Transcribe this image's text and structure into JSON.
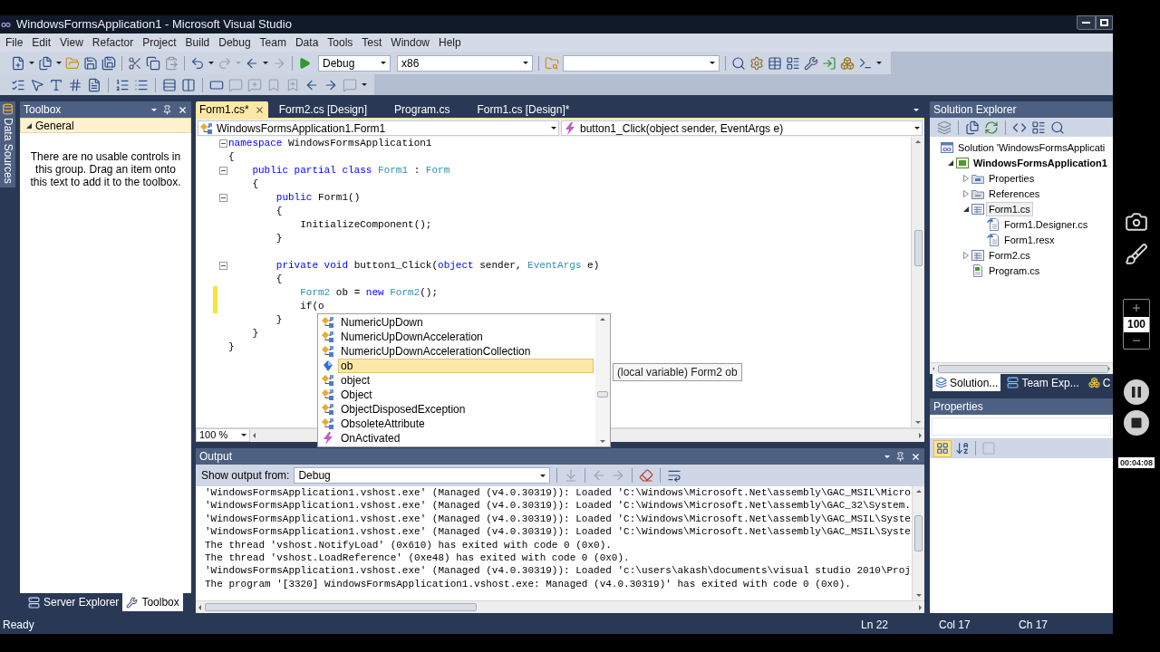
{
  "window": {
    "title": "WindowsFormsApplication1 - Microsoft Visual Studio"
  },
  "menu": [
    "File",
    "Edit",
    "View",
    "Refactor",
    "Project",
    "Build",
    "Debug",
    "Team",
    "Data",
    "Tools",
    "Test",
    "Window",
    "Help"
  ],
  "toolbar": {
    "configuration": "Debug",
    "platform": "x86"
  },
  "side_tab": {
    "label": "Data Sources"
  },
  "toolbox": {
    "title": "Toolbox",
    "group": {
      "label": "General",
      "expanded": true
    },
    "message": "There are no usable controls in this group. Drag an item onto this text to add it to the toolbox.",
    "tabs": [
      {
        "label": "Server Explorer",
        "kind": "server",
        "selected": false
      },
      {
        "label": "Toolbox",
        "kind": "toolbox",
        "selected": true
      }
    ]
  },
  "document_tabs": [
    {
      "label": "Form1.cs*",
      "selected": true
    },
    {
      "label": "Form2.cs [Design]",
      "selected": false
    },
    {
      "label": "Program.cs",
      "selected": false
    },
    {
      "label": "Form1.cs [Design]*",
      "selected": false
    }
  ],
  "editor": {
    "type_selector": "WindowsFormsApplication1.Form1",
    "member_selector": "button1_Click(object sender, EventArgs e)",
    "zoom": "100 %",
    "lines": [
      {
        "fold": true,
        "changed": false,
        "tokens": [
          {
            "kind": "keyword",
            "text": "namespace "
          },
          {
            "kind": "plain",
            "text": "WindowsFormsApplication1"
          }
        ]
      },
      {
        "fold": false,
        "changed": false,
        "tokens": [
          {
            "kind": "plain",
            "text": "{"
          }
        ]
      },
      {
        "fold": true,
        "changed": false,
        "tokens": [
          {
            "kind": "keyword",
            "text": "    public partial class "
          },
          {
            "kind": "type",
            "text": "Form1"
          },
          {
            "kind": "plain",
            "text": " : "
          },
          {
            "kind": "type",
            "text": "Form"
          }
        ]
      },
      {
        "fold": false,
        "changed": false,
        "tokens": [
          {
            "kind": "plain",
            "text": "    {"
          }
        ]
      },
      {
        "fold": true,
        "changed": false,
        "tokens": [
          {
            "kind": "keyword",
            "text": "        public "
          },
          {
            "kind": "plain",
            "text": "Form1()"
          }
        ]
      },
      {
        "fold": false,
        "changed": false,
        "tokens": [
          {
            "kind": "plain",
            "text": "        {"
          }
        ]
      },
      {
        "fold": false,
        "changed": false,
        "tokens": [
          {
            "kind": "plain",
            "text": "            InitializeComponent();"
          }
        ]
      },
      {
        "fold": false,
        "changed": false,
        "tokens": [
          {
            "kind": "plain",
            "text": "        }"
          }
        ]
      },
      {
        "fold": false,
        "changed": false
      },
      {
        "fold": true,
        "changed": false,
        "tokens": [
          {
            "kind": "keyword",
            "text": "        private void "
          },
          {
            "kind": "plain",
            "text": "button1_Click("
          },
          {
            "kind": "keyword",
            "text": "object"
          },
          {
            "kind": "plain",
            "text": " sender, "
          },
          {
            "kind": "type",
            "text": "EventArgs"
          },
          {
            "kind": "plain",
            "text": " e)"
          }
        ]
      },
      {
        "fold": false,
        "changed": false,
        "tokens": [
          {
            "kind": "plain",
            "text": "        {"
          }
        ]
      },
      {
        "fold": false,
        "changed": true,
        "tokens": [
          {
            "kind": "type",
            "text": "            Form2"
          },
          {
            "kind": "plain",
            "text": " ob = "
          },
          {
            "kind": "keyword",
            "text": "new "
          },
          {
            "kind": "type",
            "text": "Form2"
          },
          {
            "kind": "plain",
            "text": "();"
          }
        ]
      },
      {
        "fold": false,
        "changed": true,
        "tokens": [
          {
            "kind": "plain",
            "text": "            if(o"
          }
        ]
      },
      {
        "fold": false,
        "changed": false,
        "tokens": [
          {
            "kind": "plain",
            "text": "        }"
          }
        ]
      },
      {
        "fold": false,
        "changed": false,
        "tokens": [
          {
            "kind": "plain",
            "text": "    }"
          }
        ]
      },
      {
        "fold": false,
        "changed": false,
        "tokens": [
          {
            "kind": "plain",
            "text": "}"
          }
        ]
      }
    ]
  },
  "completion": {
    "items": [
      {
        "label": "NumericUpDown",
        "kind": "class",
        "selected": false
      },
      {
        "label": "NumericUpDownAcceleration",
        "kind": "class",
        "selected": false
      },
      {
        "label": "NumericUpDownAccelerationCollection",
        "kind": "class",
        "selected": false
      },
      {
        "label": "ob",
        "kind": "local",
        "selected": true
      },
      {
        "label": "object",
        "kind": "class",
        "selected": false
      },
      {
        "label": "Object",
        "kind": "class",
        "selected": false
      },
      {
        "label": "ObjectDisposedException",
        "kind": "class",
        "selected": false
      },
      {
        "label": "ObsoleteAttribute",
        "kind": "class",
        "selected": false
      },
      {
        "label": "OnActivated",
        "kind": "event",
        "selected": false
      }
    ],
    "tooltip": "(local variable) Form2 ob"
  },
  "output": {
    "title": "Output",
    "source_label": "Show output from:",
    "source": "Debug",
    "lines": [
      "'WindowsFormsApplication1.vshost.exe' (Managed (v4.0.30319)): Loaded 'C:\\Windows\\Microsoft.Net\\assembly\\GAC_MSIL\\Micro",
      "'WindowsFormsApplication1.vshost.exe' (Managed (v4.0.30319)): Loaded 'C:\\Windows\\Microsoft.Net\\assembly\\GAC_32\\System.",
      "'WindowsFormsApplication1.vshost.exe' (Managed (v4.0.30319)): Loaded 'C:\\Windows\\Microsoft.Net\\assembly\\GAC_MSIL\\Syste",
      "'WindowsFormsApplication1.vshost.exe' (Managed (v4.0.30319)): Loaded 'C:\\Windows\\Microsoft.Net\\assembly\\GAC_MSIL\\Syste",
      "The thread 'vshost.NotifyLoad' (0x610) has exited with code 0 (0x0).",
      "The thread 'vshost.LoadReference' (0xe48) has exited with code 0 (0x0).",
      "'WindowsFormsApplication1.vshost.exe' (Managed (v4.0.30319)): Loaded 'c:\\users\\akash\\documents\\visual studio 2010\\Proj",
      "The program '[3320] WindowsFormsApplication1.vshost.exe: Managed (v4.0.30319)' has exited with code 0 (0x0)."
    ]
  },
  "solution_explorer": {
    "title": "Solution Explorer",
    "tree": [
      {
        "label": "Solution 'WindowsFormsApplicati",
        "kind": "solution",
        "selected": false,
        "children": [
          {
            "label": "WindowsFormsApplication1",
            "kind": "project",
            "expanded": true,
            "selected": false,
            "children": [
              {
                "label": "Properties",
                "kind": "properties",
                "expanded": false,
                "selected": false
              },
              {
                "label": "References",
                "kind": "references",
                "expanded": false,
                "selected": false
              },
              {
                "label": "Form1.cs",
                "kind": "form",
                "expanded": true,
                "selected": true,
                "children": [
                  {
                    "label": "Form1.Designer.cs",
                    "kind": "dependent",
                    "selected": false
                  },
                  {
                    "label": "Form1.resx",
                    "kind": "dependent",
                    "selected": false
                  }
                ]
              },
              {
                "label": "Form2.cs",
                "kind": "form",
                "expanded": false,
                "selected": false
              },
              {
                "label": "Program.cs",
                "kind": "code",
                "selected": false
              }
            ]
          }
        ]
      }
    ],
    "tabs": [
      {
        "label": "Solution...",
        "kind": "solution",
        "selected": true
      },
      {
        "label": "Team Exp...",
        "kind": "team",
        "selected": false
      },
      {
        "label": "C",
        "kind": "class",
        "selected": false
      }
    ]
  },
  "properties": {
    "title": "Properties"
  },
  "status_bar": {
    "message": "Ready",
    "line": "Ln 22",
    "column": "Col 17",
    "char": "Ch 17"
  },
  "recorder": {
    "zoom": "100",
    "timer": "00:04:08"
  }
}
